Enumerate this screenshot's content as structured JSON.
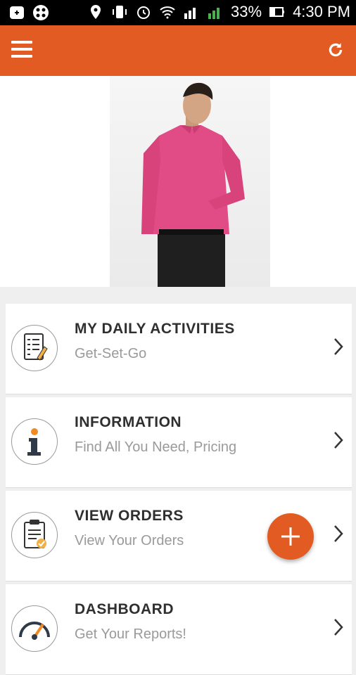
{
  "status_bar": {
    "battery": "33%",
    "time": "4:30 PM"
  },
  "colors": {
    "accent": "#e15b22"
  },
  "app_bar": {
    "menu_icon": "hamburger-menu-icon",
    "refresh_icon": "refresh-icon"
  },
  "menu_items": [
    {
      "title": "MY DAILY ACTIVITIES",
      "subtitle": "Get-Set-Go",
      "icon": "checklist-icon"
    },
    {
      "title": "INFORMATION",
      "subtitle": "Find All You Need, Pricing",
      "icon": "info-icon"
    },
    {
      "title": "VIEW ORDERS",
      "subtitle": "View Your Orders",
      "icon": "clipboard-icon"
    },
    {
      "title": "DASHBOARD",
      "subtitle": "Get Your Reports!",
      "icon": "gauge-icon"
    }
  ],
  "fab": {
    "icon": "plus-icon"
  }
}
